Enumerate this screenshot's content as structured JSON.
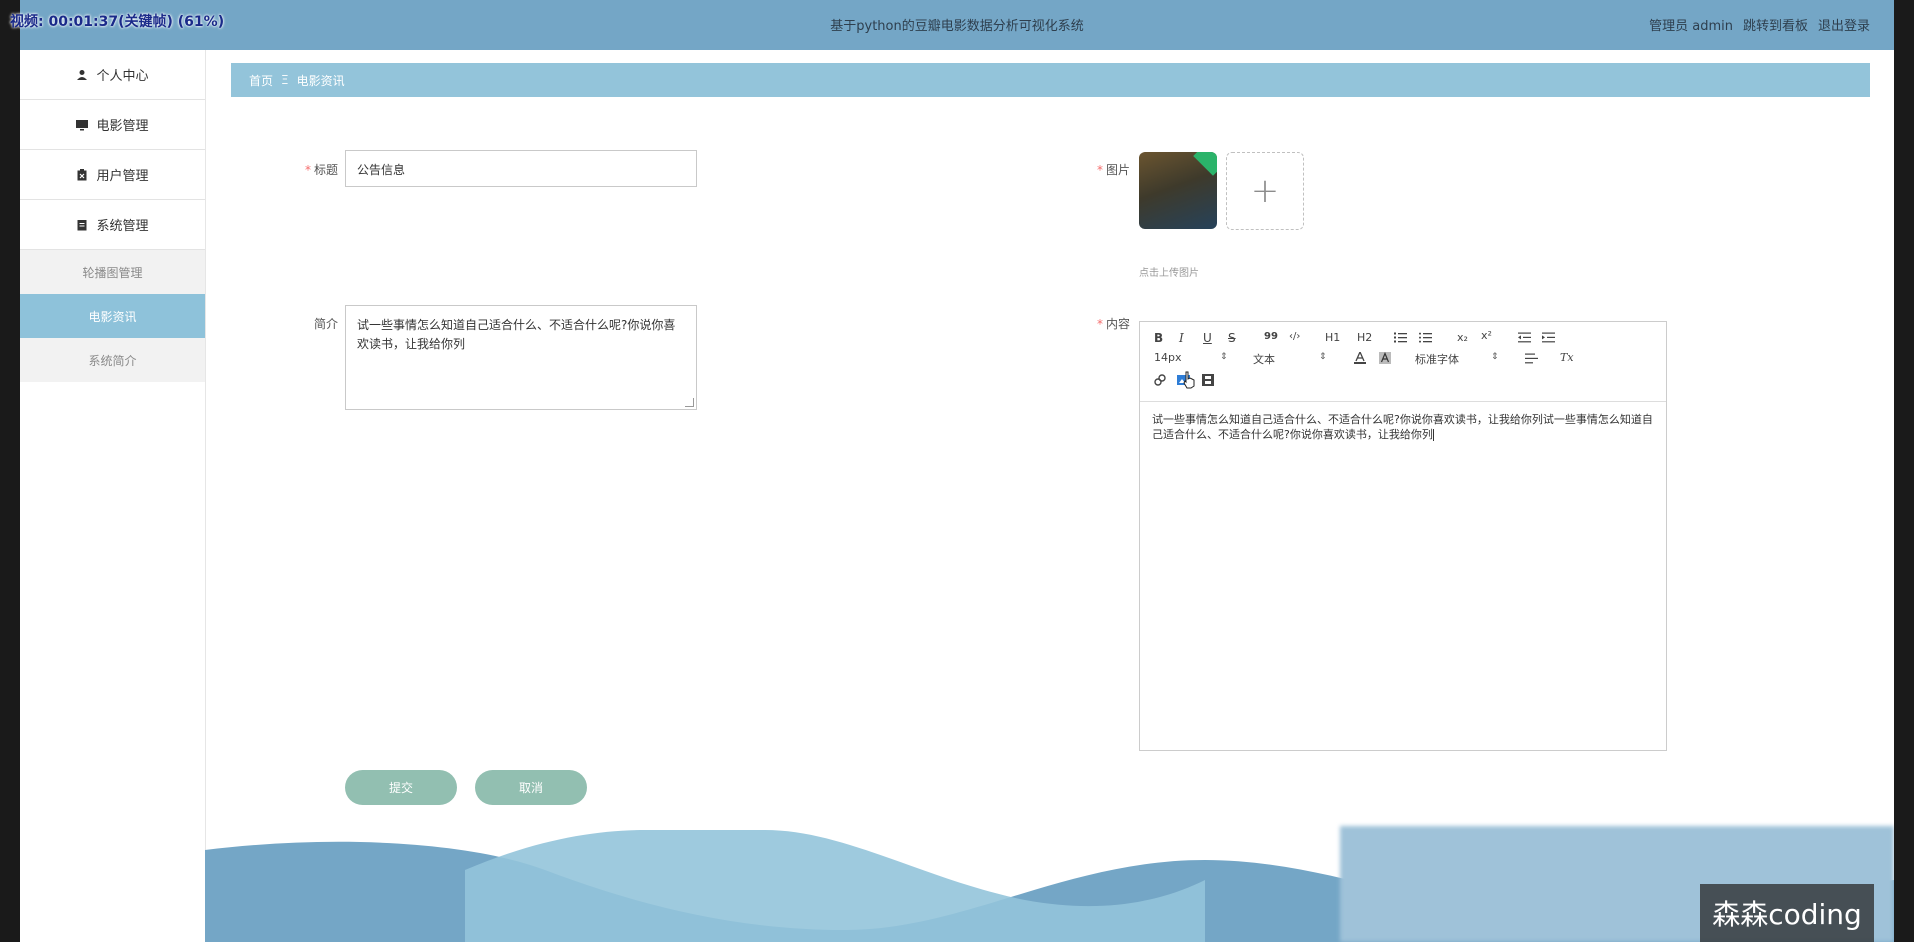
{
  "timer": "视频: 00:01:37(关键帧) (61%)",
  "topbar": {
    "title": "基于python的豆瓣电影数据分析可视化系统",
    "user": "管理员 admin",
    "dashboard_link": "跳转到看板",
    "logout": "退出登录"
  },
  "sidebar": {
    "items": [
      {
        "label": "个人中心",
        "icon": "person-icon"
      },
      {
        "label": "电影管理",
        "icon": "monitor-icon"
      },
      {
        "label": "用户管理",
        "icon": "clipboard-icon"
      },
      {
        "label": "系统管理",
        "icon": "document-icon"
      }
    ],
    "sub_items": [
      {
        "label": "轮播图管理",
        "active": false
      },
      {
        "label": "电影资讯",
        "active": true
      },
      {
        "label": "系统简介",
        "active": false
      }
    ]
  },
  "breadcrumb": {
    "home": "首页",
    "separator": "Ξ",
    "current": "电影资讯"
  },
  "form": {
    "title_label": "标题",
    "title_value": "公告信息",
    "intro_label": "简介",
    "intro_value": "试一些事情怎么知道自己适合什么、不适合什么呢?你说你喜欢读书，让我给你列",
    "image_label": "图片",
    "upload_hint": "点击上传图片",
    "content_label": "内容",
    "content_value": "试一些事情怎么知道自己适合什么、不适合什么呢?你说你喜欢读书，让我给你列试一些事情怎么知道自己适合什么、不适合什么呢?你说你喜欢读书，让我给你列",
    "submit": "提交",
    "cancel": "取消"
  },
  "editor_toolbar": {
    "bold": "B",
    "italic": "I",
    "underline": "U",
    "strike": "S",
    "quote": "99",
    "code": "‹/›",
    "h1": "H1",
    "h2": "H2",
    "sub": "x₂",
    "sup": "x²",
    "font_size": "14px",
    "block_type": "文本",
    "font_family": "标准字体",
    "clear": "Tx"
  },
  "watermark": "森森coding",
  "colors": {
    "topbar": "#74a6c6",
    "breadcrumb": "#93c4da",
    "active_menu": "#8ec2da",
    "button": "#92bfb1",
    "required": "#f56c6c"
  }
}
